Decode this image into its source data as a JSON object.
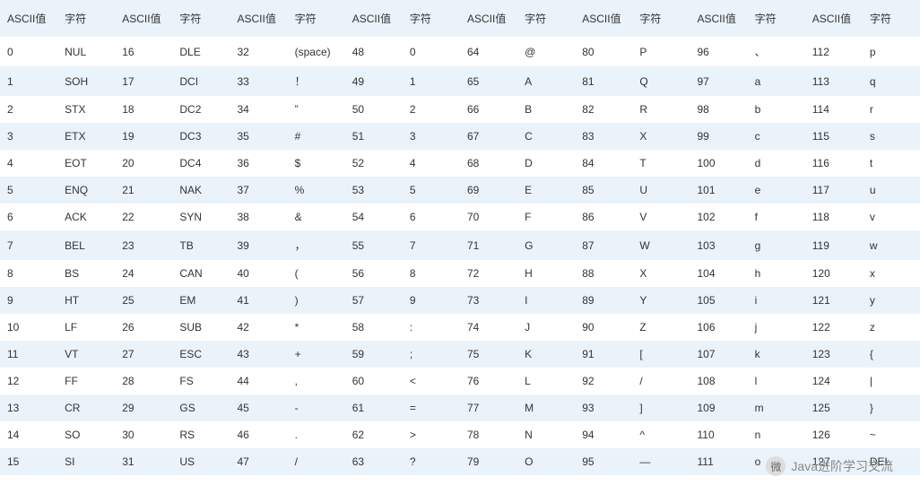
{
  "headers": [
    "ASCII值",
    "字符",
    "ASCII值",
    "字符",
    "ASCII值",
    "字符",
    "ASCII值",
    "字符",
    "ASCII值",
    "字符",
    "ASCII值",
    "字符",
    "ASCII值",
    "字符",
    "ASCII值",
    "字符"
  ],
  "rows": [
    [
      "0",
      "NUL",
      "16",
      "DLE",
      "32",
      "(space)",
      "48",
      "0",
      "64",
      "@",
      "80",
      "P",
      "96",
      "、",
      "112",
      "p"
    ],
    [
      "1",
      "SOH",
      "17",
      "DCI",
      "33",
      "！",
      "49",
      "1",
      "65",
      "A",
      "81",
      "Q",
      "97",
      "a",
      "113",
      "q"
    ],
    [
      "2",
      "STX",
      "18",
      "DC2",
      "34",
      "”",
      "50",
      "2",
      "66",
      "B",
      "82",
      "R",
      "98",
      "b",
      "114",
      "r"
    ],
    [
      "3",
      "ETX",
      "19",
      "DC3",
      "35",
      "#",
      "51",
      "3",
      "67",
      "C",
      "83",
      "X",
      "99",
      "c",
      "115",
      "s"
    ],
    [
      "4",
      "EOT",
      "20",
      "DC4",
      "36",
      "$",
      "52",
      "4",
      "68",
      "D",
      "84",
      "T",
      "100",
      "d",
      "116",
      "t"
    ],
    [
      "5",
      "ENQ",
      "21",
      "NAK",
      "37",
      "%",
      "53",
      "5",
      "69",
      "E",
      "85",
      "U",
      "101",
      "e",
      "117",
      "u"
    ],
    [
      "6",
      "ACK",
      "22",
      "SYN",
      "38",
      "&",
      "54",
      "6",
      "70",
      "F",
      "86",
      "V",
      "102",
      "f",
      "118",
      "v"
    ],
    [
      "7",
      "BEL",
      "23",
      "TB",
      "39",
      "，",
      "55",
      "7",
      "71",
      "G",
      "87",
      "W",
      "103",
      "g",
      "119",
      "w"
    ],
    [
      "8",
      "BS",
      "24",
      "CAN",
      "40",
      "(",
      "56",
      "8",
      "72",
      "H",
      "88",
      "X",
      "104",
      "h",
      "120",
      "x"
    ],
    [
      "9",
      "HT",
      "25",
      "EM",
      "41",
      ")",
      "57",
      "9",
      "73",
      "I",
      "89",
      "Y",
      "105",
      "i",
      "121",
      "y"
    ],
    [
      "10",
      "LF",
      "26",
      "SUB",
      "42",
      "*",
      "58",
      ":",
      "74",
      "J",
      "90",
      "Z",
      "106",
      "j",
      "122",
      "z"
    ],
    [
      "11",
      "VT",
      "27",
      "ESC",
      "43",
      "+",
      "59",
      ";",
      "75",
      "K",
      "91",
      "[",
      "107",
      "k",
      "123",
      "{"
    ],
    [
      "12",
      "FF",
      "28",
      "FS",
      "44",
      ",",
      "60",
      "<",
      "76",
      "L",
      "92",
      "/",
      "108",
      "l",
      "124",
      "|"
    ],
    [
      "13",
      "CR",
      "29",
      "GS",
      "45",
      "-",
      "61",
      "=",
      "77",
      "M",
      "93",
      "]",
      "109",
      "m",
      "125",
      "}"
    ],
    [
      "14",
      "SO",
      "30",
      "RS",
      "46",
      ".",
      "62",
      ">",
      "78",
      "N",
      "94",
      "^",
      "110",
      "n",
      "126",
      "~"
    ],
    [
      "15",
      "SI",
      "31",
      "US",
      "47",
      "/",
      "63",
      "?",
      "79",
      "O",
      "95",
      "—",
      "111",
      "o",
      "127",
      "DEL"
    ]
  ],
  "watermark": {
    "icon": "微",
    "text": "Java进阶学习交流"
  }
}
